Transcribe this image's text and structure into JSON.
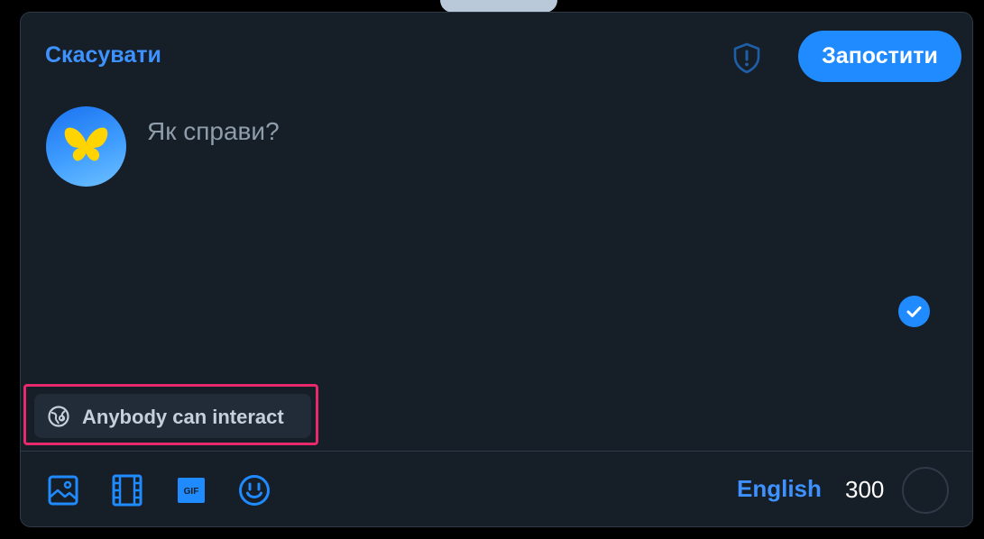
{
  "header": {
    "cancel_label": "Скасувати",
    "post_label": "Запостити",
    "content_warning_icon": "shield-exclamation-icon"
  },
  "composer": {
    "placeholder": "Як справи?",
    "text": "",
    "avatar_icon": "butterfly-icon",
    "thread_indicator_icon": "check-icon"
  },
  "interaction_settings": {
    "label": "Anybody can interact",
    "icon": "globe-icon"
  },
  "toolbar": {
    "tools": [
      {
        "name": "image-icon"
      },
      {
        "name": "video-icon"
      },
      {
        "name": "gif-icon"
      },
      {
        "name": "emoji-icon"
      }
    ],
    "language": "English",
    "char_count": "300",
    "char_progress": 0
  },
  "colors": {
    "background": "#161e27",
    "accent": "#208bfe",
    "link": "#3e92ff",
    "highlight": "#e8296c",
    "butterfly": "#ffd400"
  }
}
